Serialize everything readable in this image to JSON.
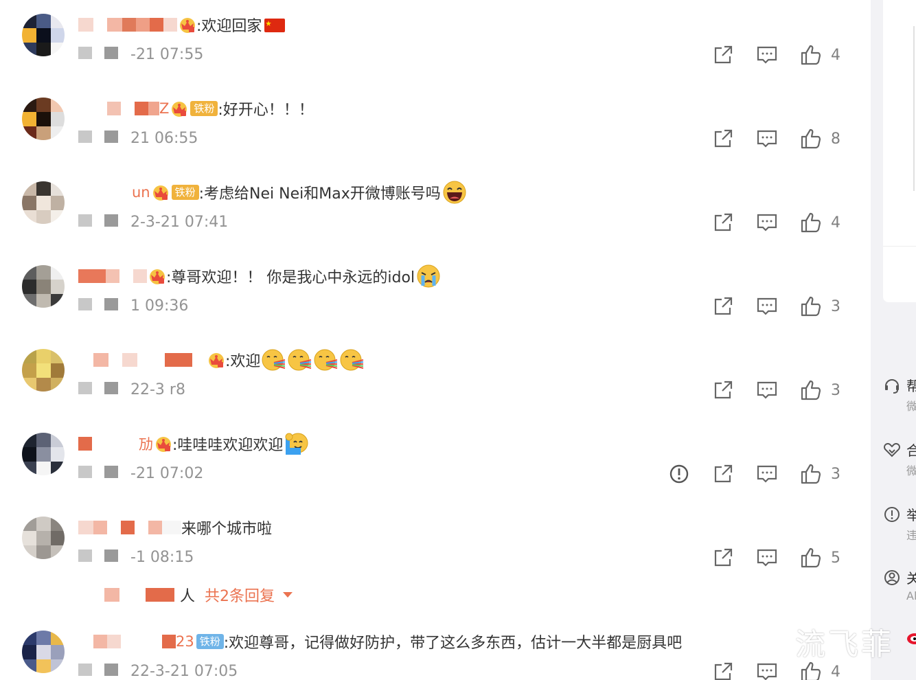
{
  "colors": {
    "accent": "#eb7350",
    "timestamp": "#939393",
    "badge_gold": "#f0b23c",
    "badge_blue": "#6fb4e8"
  },
  "comments": [
    {
      "name_frag": "",
      "badge": "",
      "text": ":欢迎回家",
      "emoji_after": [
        "china-flag"
      ],
      "time": "-21 07:55",
      "likes": "4",
      "report": false
    },
    {
      "name_frag": "Z",
      "badge": "铁粉",
      "text": ":好开心！！！",
      "emoji_after": [],
      "time": "21 06:55",
      "likes": "8",
      "report": false
    },
    {
      "name_frag": "un",
      "badge": "铁粉",
      "text": ":考虑给Nei Nei和Max开微博账号吗",
      "emoji_after": [
        "laughing-emoji"
      ],
      "time": "2-3-21 07:41",
      "likes": "4",
      "report": false
    },
    {
      "name_frag": "",
      "badge": "",
      "text": ":尊哥欢迎！！ 你是我心中永远的idol",
      "emoji_after": [
        "crying-emoji"
      ],
      "time": "1 09:36",
      "likes": "3",
      "report": false
    },
    {
      "name_frag": "",
      "badge": "",
      "text": ":欢迎",
      "emoji_after": [
        "rainbow-emoji",
        "rainbow-emoji",
        "rainbow-emoji",
        "rainbow-emoji"
      ],
      "time": "22-3",
      "time_tail": "r8",
      "likes": "3",
      "report": false
    },
    {
      "name_frag": "劢",
      "badge": "",
      "text": ":哇哇哇欢迎欢迎",
      "emoji_after": [
        "waving-emoji"
      ],
      "time": "-21 07:02",
      "likes": "3",
      "report": true
    },
    {
      "name_frag": "",
      "badge": "",
      "text": "来哪个城市啦",
      "emoji_after": [],
      "time": "-1 08:15",
      "likes": "5",
      "report": false
    },
    {
      "name_frag": "23",
      "badge": "铁粉",
      "text": ":欢迎尊哥，记得做好防护，带了这么多东西，估计一大半都是厨具吧",
      "emoji_after": [],
      "time": "22-3-21 07:05",
      "likes": "4",
      "report": false
    }
  ],
  "replies": {
    "who": "人",
    "more_label": "共2条回复"
  },
  "sidebar": {
    "items": [
      {
        "label": "帮",
        "sub": "微",
        "icon": "headset-icon"
      },
      {
        "label": "合",
        "sub": "微",
        "icon": "handshake-icon"
      },
      {
        "label": "举",
        "sub": "违",
        "icon": "report-icon"
      },
      {
        "label": "关",
        "sub": "Al",
        "icon": "user-circle-icon"
      }
    ],
    "card_flick": "r"
  },
  "watermark": "流飞菲"
}
